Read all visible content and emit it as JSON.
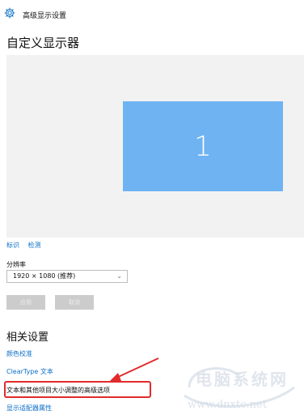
{
  "header": {
    "icon": "gear-icon",
    "title": "高级显示设置"
  },
  "customize": {
    "title": "自定义显示器",
    "monitor_label": "1",
    "identify_label": "标识",
    "detect_label": "检测"
  },
  "resolution": {
    "label": "分辨率",
    "value": "1920 × 1080 (推荐)",
    "apply_label": "应用",
    "cancel_label": "取消"
  },
  "related": {
    "title": "相关设置",
    "links": [
      "颜色校准",
      "ClearType 文本",
      "文本和其他项目大小调整的高级选项",
      "显示适配器属性"
    ]
  },
  "watermark": {
    "line1": "电脑系统网",
    "line2": "www.dnxtc.net"
  },
  "colors": {
    "accent": "#0b6fc7",
    "monitor": "#6fb3f2",
    "highlight": "#e02b2b"
  }
}
